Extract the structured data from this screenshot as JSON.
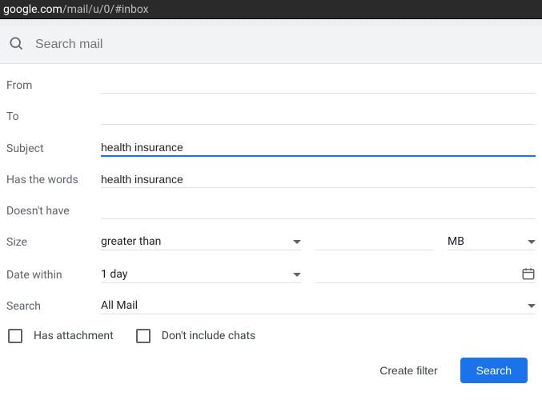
{
  "url": {
    "domain": "google.com",
    "path": "/mail/u/0/#inbox"
  },
  "search": {
    "placeholder": "Search mail"
  },
  "labels": {
    "from": "From",
    "to": "To",
    "subject": "Subject",
    "has_words": "Has the words",
    "doesnt_have": "Doesn't have",
    "size": "Size",
    "date_within": "Date within",
    "search": "Search",
    "has_attachment": "Has attachment",
    "no_chats": "Don't include chats"
  },
  "values": {
    "from": "",
    "to": "",
    "subject": "health insurance",
    "has_words": "health insurance",
    "doesnt_have": "",
    "size_op": "greater than",
    "size_val": "",
    "size_unit": "MB",
    "date_within": "1 day",
    "search_in": "All Mail"
  },
  "buttons": {
    "create_filter": "Create filter",
    "search": "Search"
  }
}
